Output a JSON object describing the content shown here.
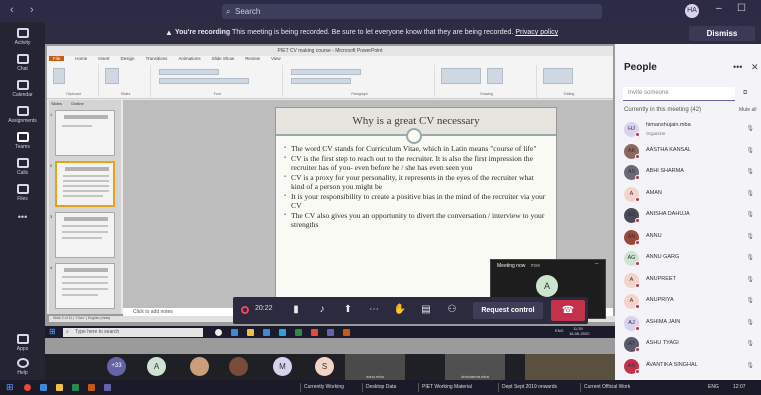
{
  "titlebar": {
    "back": "‹",
    "forward": "›",
    "search_placeholder": "Search",
    "avatar_initials": "HA",
    "minimize": "–",
    "maximize": "☐"
  },
  "rail": [
    {
      "label": "Activity"
    },
    {
      "label": "Chat"
    },
    {
      "label": "Calendar"
    },
    {
      "label": "Assignments"
    },
    {
      "label": "Teams"
    },
    {
      "label": "Calls"
    },
    {
      "label": "Files"
    },
    {
      "label": "•••"
    },
    {
      "label": "Apps"
    },
    {
      "label": "Help"
    }
  ],
  "banner": {
    "bold": "You're recording",
    "text": " This meeting is being recorded. Be sure to let everyone know that they are being recorded.",
    "link": "Privacy policy",
    "dismiss": "Dismiss"
  },
  "ppt": {
    "window_title": "PIET CV making course - Microsoft PowerPoint",
    "tabs": [
      "File",
      "Home",
      "Insert",
      "Design",
      "Transitions",
      "Animations",
      "Slide Show",
      "Review",
      "View"
    ],
    "groups": [
      "Clipboard",
      "Slides",
      "Font",
      "Paragraph",
      "Drawing",
      "Editing"
    ],
    "pane_tabs": [
      "Slides",
      "Outline"
    ],
    "thumb_numbers": [
      "1",
      "2",
      "3",
      "4"
    ],
    "notes_placeholder": "Click to add notes",
    "status": "Slide 2 of 11 | \"Civic\" | English (India)"
  },
  "slide": {
    "title": "Why is a great CV necessary",
    "bullets": [
      "The word CV stands for Curriculum Vitae, which in Latin means \"course of life\"",
      "CV is the first step to reach out to the recruiter. It is also the first impression the recruiter has of you- even before he / she has even seen you",
      "CV is a proxy for your personality, it represents in the eyes of the recruiter what kind of a person you might be",
      "It is your responsibility to create a positive bias in the mind of the recruiter via your CV",
      "The CV also gives you an opportunity to divert the conversation / interview to your strengths"
    ]
  },
  "win_taskbar": {
    "search": "Type here to search",
    "clock_time": "11:39",
    "clock_date": "18-06-2020",
    "lang": "ENG"
  },
  "controls": {
    "timer": "20:22",
    "request_control": "Request control",
    "hangup_glyph": "☎"
  },
  "popup": {
    "title": "Meeting now",
    "owner": "mse",
    "avatar": "A"
  },
  "strip": {
    "count": "+33",
    "avatars": [
      "A",
      "M",
      "S"
    ],
    "tiles": [
      "sonu.mba",
      "dmcharma.mba"
    ]
  },
  "people": {
    "title": "People",
    "more": "•••",
    "close": "✕",
    "invite_placeholder": "Invite someone",
    "current_label": "Currently in this meeting (42)",
    "more_options": "Mute all",
    "members": [
      {
        "name": "himanshujain.mba",
        "role": "Organizer",
        "initials": "HJ",
        "color": "#d8d2ee"
      },
      {
        "name": "AASTHA KANSAL",
        "role": "",
        "initials": "AK",
        "color": "#8a6a5a"
      },
      {
        "name": "ABHI SHARMA",
        "role": "",
        "initials": "AS",
        "color": "#6a6a7a"
      },
      {
        "name": "AMAN",
        "role": "",
        "initials": "A",
        "color": "#f3d4c8"
      },
      {
        "name": "ANISHA DAHUJA",
        "role": "",
        "initials": "AD",
        "color": "#4a4a5a"
      },
      {
        "name": "ANNU",
        "role": "",
        "initials": "AN",
        "color": "#9a4a3a"
      },
      {
        "name": "ANNU GARG",
        "role": "",
        "initials": "AG",
        "color": "#cfe3d3"
      },
      {
        "name": "ANUPREET",
        "role": "",
        "initials": "A",
        "color": "#f3d4c8"
      },
      {
        "name": "ANUPRIYA",
        "role": "",
        "initials": "A",
        "color": "#f3d4c8"
      },
      {
        "name": "ASHIMA JAIN",
        "role": "",
        "initials": "AJ",
        "color": "#d8d2ee"
      },
      {
        "name": "ASHU TYAGI",
        "role": "",
        "initials": "AT",
        "color": "#5a5a6a"
      },
      {
        "name": "AVANTIKA SINGHAL",
        "role": "",
        "initials": "AS",
        "color": "#c4314b"
      }
    ]
  },
  "os_taskbar": {
    "tabs": [
      "Currently Working",
      "Desktop Data",
      "PIET Working Material",
      "Dept Sept 2019 onwards",
      "Current Official Work"
    ],
    "time": "12:07",
    "lang": "ENG"
  },
  "colors": {
    "teams_purple": "#6264a7",
    "hangup_red": "#c4314b",
    "ppt_orange": "#c55a11"
  }
}
